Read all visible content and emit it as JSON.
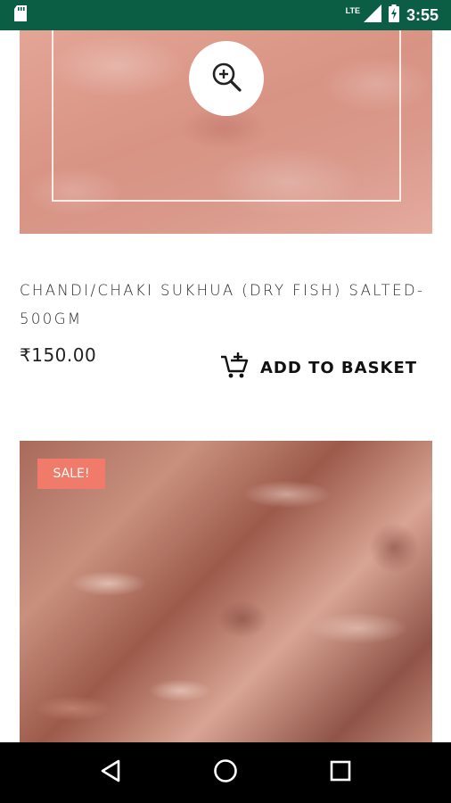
{
  "status_bar": {
    "time": "3:55",
    "network": "LTE",
    "icons": [
      "sd-card-icon",
      "signal-icon",
      "battery-charging-icon"
    ]
  },
  "products": [
    {
      "image_tint": "#d89384",
      "zoom_icon": "zoom-in-icon",
      "title": "CHANDI/CHAKI SUKHUA (DRY FISH) SALTED-500GM",
      "price": "₹150.00",
      "add_to_basket_label": "ADD TO BASKET",
      "add_to_basket_icon": "cart-plus-icon"
    },
    {
      "badge": "SALE!",
      "badge_color": "#f07b6a"
    }
  ],
  "nav_bar": {
    "buttons": [
      "back-icon",
      "home-icon",
      "recents-icon"
    ]
  },
  "colors": {
    "status_bar": "#0b5e44",
    "nav_bar": "#000000"
  }
}
